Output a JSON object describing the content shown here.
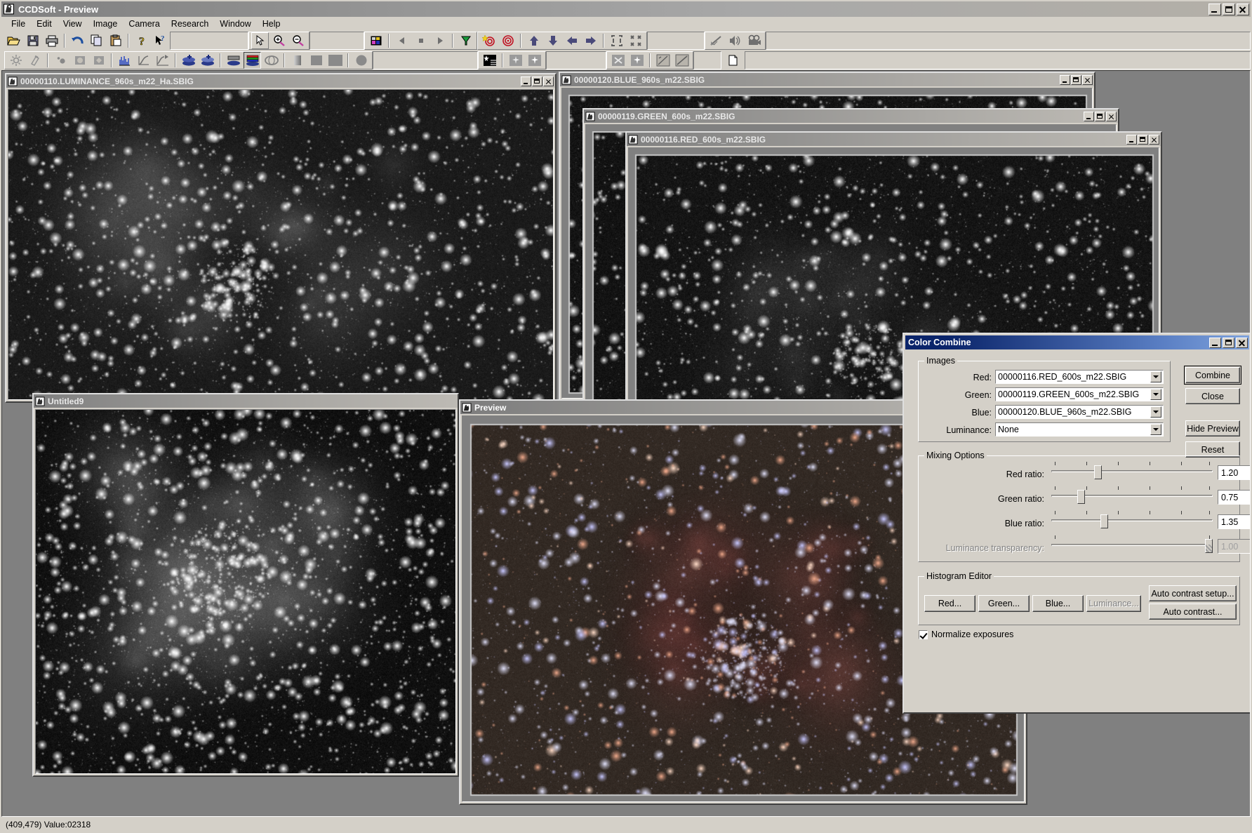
{
  "app": {
    "title": "CCDSoft  - Preview",
    "icon": "hand-telescope-icon",
    "min_label": "_",
    "max_label": "□",
    "close_label": "✕"
  },
  "menu": {
    "items": [
      {
        "label": "File"
      },
      {
        "label": "Edit"
      },
      {
        "label": "View"
      },
      {
        "label": "Image"
      },
      {
        "label": "Camera"
      },
      {
        "label": "Research"
      },
      {
        "label": "Window"
      },
      {
        "label": "Help"
      }
    ]
  },
  "toolbar1": {
    "groups": [
      {
        "buttons": [
          {
            "name": "open-file-icon",
            "label": "Open"
          },
          {
            "name": "save-file-icon",
            "label": "Save"
          },
          {
            "name": "print-icon",
            "label": "Print"
          }
        ]
      },
      {
        "buttons": [
          {
            "name": "undo-icon",
            "label": "Undo"
          },
          {
            "name": "copy-icon",
            "label": "Copy"
          },
          {
            "name": "paste-icon",
            "label": "Paste"
          }
        ]
      },
      {
        "buttons": [
          {
            "name": "help-icon",
            "label": "Help"
          },
          {
            "name": "context-help-icon",
            "label": "What's This"
          }
        ]
      },
      {
        "buttons": [
          {
            "name": "pointer-icon",
            "label": "Select"
          },
          {
            "name": "zoom-in-icon",
            "label": "Zoom In"
          },
          {
            "name": "zoom-out-icon",
            "label": "Zoom Out"
          }
        ]
      },
      {
        "buttons": [
          {
            "name": "color-palette-icon",
            "label": "Palette"
          },
          {
            "name": "prev-frame-icon",
            "label": "Previous"
          },
          {
            "name": "stop-icon",
            "label": "Stop"
          },
          {
            "name": "next-frame-icon",
            "label": "Next"
          },
          {
            "name": "filter-wheel-icon",
            "label": "Filter Wheel"
          }
        ]
      },
      {
        "buttons": [
          {
            "name": "target-star-icon",
            "label": "Find Star"
          },
          {
            "name": "target-icon",
            "label": "Target"
          },
          {
            "name": "move-up-icon",
            "label": "Up"
          },
          {
            "name": "move-down-icon",
            "label": "Down"
          },
          {
            "name": "move-left-icon",
            "label": "Left"
          },
          {
            "name": "move-right-icon",
            "label": "Right"
          },
          {
            "name": "expand-frame-icon",
            "label": "Full Frame"
          },
          {
            "name": "collapse-frame-icon",
            "label": "Subframe"
          }
        ]
      },
      {
        "buttons": [
          {
            "name": "pen-graph-icon",
            "label": "Annotate"
          },
          {
            "name": "sound-icon",
            "label": "Sound"
          },
          {
            "name": "movie-camera-icon",
            "label": "Movie"
          }
        ]
      }
    ]
  },
  "toolbar2": {
    "groups": [
      {
        "buttons": [
          {
            "name": "brightness-icon",
            "label": "Brightness"
          },
          {
            "name": "flashlight-icon",
            "label": "Flash"
          }
        ]
      },
      {
        "buttons": [
          {
            "name": "dot-pair-icon",
            "label": "Stars"
          },
          {
            "name": "circle-box-icon",
            "label": "Aperture"
          },
          {
            "name": "diamond-box-icon",
            "label": "Diamond"
          }
        ]
      },
      {
        "buttons": [
          {
            "name": "histogram-icon",
            "label": "Histogram"
          },
          {
            "name": "curve-icon",
            "label": "Curve"
          },
          {
            "name": "transfer-curve-icon",
            "label": "Transfer Function"
          }
        ]
      },
      {
        "buttons": [
          {
            "name": "add-layer-icon",
            "label": "Add Image"
          },
          {
            "name": "add-layer-alt-icon",
            "label": "Combine Image"
          }
        ]
      },
      {
        "buttons": [
          {
            "name": "layers-gray-icon",
            "label": "Gray Combine"
          },
          {
            "name": "layers-rgb-icon",
            "label": "Color Combine"
          },
          {
            "name": "layers-rotate-icon",
            "label": "Rotate Layers"
          }
        ]
      },
      {
        "buttons": [
          {
            "name": "gradient-bar-icon",
            "label": "Gradient"
          },
          {
            "name": "square-fill-icon",
            "label": "Fill"
          },
          {
            "name": "square-large-icon",
            "label": "Square"
          },
          {
            "name": "circle-fill-icon",
            "label": "Circle"
          }
        ]
      },
      {
        "buttons": [
          {
            "name": "star-grid-icon",
            "label": "Star Grid"
          },
          {
            "name": "star-dim-icon",
            "label": "Star A"
          },
          {
            "name": "star-dim2-icon",
            "label": "Star B"
          }
        ]
      },
      {
        "buttons": [
          {
            "name": "star-remove-icon",
            "label": "Remove Star"
          },
          {
            "name": "star-add-icon",
            "label": "Add Star"
          },
          {
            "name": "line-measure-icon",
            "label": "Measure"
          },
          {
            "name": "diagonal-line-icon",
            "label": "Line"
          }
        ]
      },
      {
        "buttons": [
          {
            "name": "new-doc-icon",
            "label": "New"
          }
        ]
      }
    ]
  },
  "windows": [
    {
      "name": "luminance-window",
      "title": "00000110.LUMINANCE_960s_m22_Ha.SBIG",
      "active": false
    },
    {
      "name": "blue-window",
      "title": "00000120.BLUE_960s_m22.SBIG",
      "active": false
    },
    {
      "name": "green-window",
      "title": "00000119.GREEN_600s_m22.SBIG",
      "active": false
    },
    {
      "name": "red-window",
      "title": "00000116.RED_600s_m22.SBIG",
      "active": false
    },
    {
      "name": "untitled9-window",
      "title": "Untitled9",
      "active": false
    },
    {
      "name": "preview-window",
      "title": "Preview",
      "active": true
    }
  ],
  "dialog": {
    "title": "Color Combine",
    "images_group": {
      "legend": "Images",
      "fields": [
        {
          "label": "Red:",
          "value": "00000116.RED_600s_m22.SBIG",
          "disabled": false
        },
        {
          "label": "Green:",
          "value": "00000119.GREEN_600s_m22.SBIG",
          "disabled": false
        },
        {
          "label": "Blue:",
          "value": "00000120.BLUE_960s_m22.SBIG",
          "disabled": false
        },
        {
          "label": "Luminance:",
          "value": "None",
          "disabled": false
        }
      ]
    },
    "mixing_group": {
      "legend": "Mixing Options",
      "sliders": [
        {
          "label": "Red ratio:",
          "value": "1.20",
          "pos": 0.275,
          "disabled": false
        },
        {
          "label": "Green ratio:",
          "value": "0.75",
          "pos": 0.155,
          "disabled": false
        },
        {
          "label": "Blue ratio:",
          "value": "1.35",
          "pos": 0.315,
          "disabled": false
        },
        {
          "label": "Luminance transparency:",
          "value": "1.00",
          "pos": 0.965,
          "disabled": true
        }
      ]
    },
    "histogram_group": {
      "legend": "Histogram Editor",
      "buttons": [
        {
          "label": "Red...",
          "disabled": false
        },
        {
          "label": "Green...",
          "disabled": false
        },
        {
          "label": "Blue...",
          "disabled": false
        },
        {
          "label": "Luminance...",
          "disabled": true
        }
      ],
      "auto_buttons": [
        {
          "label": "Auto contrast setup...",
          "disabled": false
        },
        {
          "label": "Auto contrast...",
          "disabled": false
        }
      ]
    },
    "normalize": {
      "label": "Normalize exposures",
      "checked": true
    },
    "action_buttons": [
      {
        "label": "Combine",
        "default": true
      },
      {
        "label": "Close",
        "default": false
      },
      {
        "label": "Hide Preview",
        "default": false
      },
      {
        "label": "Reset",
        "default": false
      }
    ]
  },
  "statusbar": {
    "text": "(409,479) Value:02318"
  },
  "colors": {
    "face": "#d4d0c8",
    "title_active": "#0a246a",
    "title_inactive": "#808080",
    "desktop": "#808080",
    "preview_nebula": "#7a4a44",
    "preview_sky": "#3a302a"
  }
}
